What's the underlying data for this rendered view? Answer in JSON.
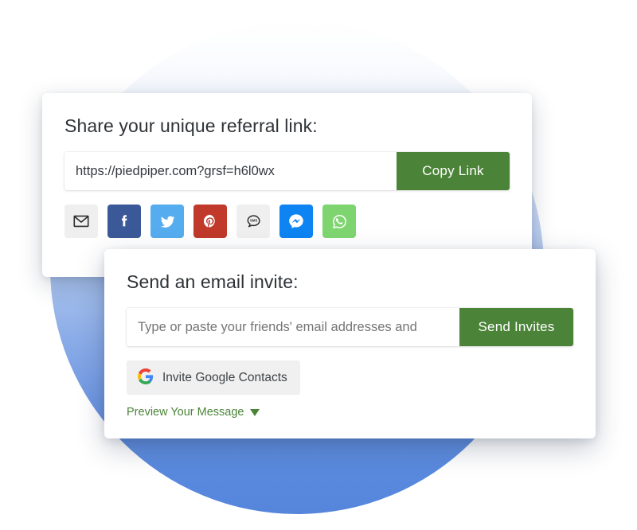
{
  "theme": {
    "accent_green": "#4b8438",
    "circle_blue": "#5a8ade",
    "card_background": "#ffffff"
  },
  "share_card": {
    "title": "Share your unique referral link:",
    "referral_link": "https://piedpiper.com?grsf=h6l0wx",
    "copy_button_label": "Copy Link",
    "social_buttons": [
      {
        "name": "email",
        "label": "Email",
        "icon": "envelope-icon",
        "bg": "#efefef",
        "fg": "#2b2b2b"
      },
      {
        "name": "facebook",
        "label": "Facebook",
        "icon": "facebook-icon",
        "bg": "#3b5998",
        "fg": "#ffffff"
      },
      {
        "name": "twitter",
        "label": "Twitter",
        "icon": "twitter-icon",
        "bg": "#55acee",
        "fg": "#ffffff"
      },
      {
        "name": "pinterest",
        "label": "Pinterest",
        "icon": "pinterest-icon",
        "bg": "#c0392b",
        "fg": "#ffffff"
      },
      {
        "name": "sms",
        "label": "SMS",
        "icon": "sms-icon",
        "bg": "#efefef",
        "fg": "#2b2b2b"
      },
      {
        "name": "messenger",
        "label": "Messenger",
        "icon": "messenger-icon",
        "bg": "#0d84f2",
        "fg": "#ffffff"
      },
      {
        "name": "whatsapp",
        "label": "WhatsApp",
        "icon": "whatsapp-icon",
        "bg": "#7ed56f",
        "fg": "#ffffff"
      }
    ]
  },
  "email_card": {
    "title": "Send an email invite:",
    "email_input_placeholder": "Type or paste your friends' email addresses and",
    "email_input_value": "",
    "send_button_label": "Send Invites",
    "google_contacts_label": "Invite Google Contacts",
    "google_icon": "google-g-icon",
    "preview_label": "Preview Your Message",
    "preview_caret": "chevron-down-icon"
  }
}
